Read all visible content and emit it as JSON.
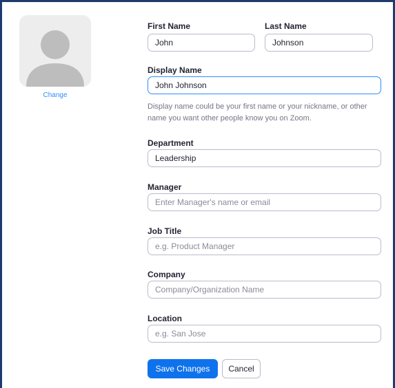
{
  "profile": {
    "change_label": "Change"
  },
  "form": {
    "first_name": {
      "label": "First Name",
      "value": "John"
    },
    "last_name": {
      "label": "Last Name",
      "value": "Johnson"
    },
    "display_name": {
      "label": "Display Name",
      "value": "John Johnson",
      "helper": "Display name could be your first name or your nickname, or other name you want other people know you on Zoom."
    },
    "department": {
      "label": "Department",
      "value": "Leadership"
    },
    "manager": {
      "label": "Manager",
      "placeholder": "Enter Manager's name or email"
    },
    "job_title": {
      "label": "Job Title",
      "placeholder": "e.g. Product Manager"
    },
    "company": {
      "label": "Company",
      "placeholder": "Company/Organization Name"
    },
    "location": {
      "label": "Location",
      "placeholder": "e.g. San Jose"
    }
  },
  "actions": {
    "save_label": "Save Changes",
    "cancel_label": "Cancel"
  },
  "colors": {
    "primary": "#0e72ed",
    "link": "#2d8cff",
    "frame_border": "#1e3a6e",
    "input_border": "#babacc"
  }
}
